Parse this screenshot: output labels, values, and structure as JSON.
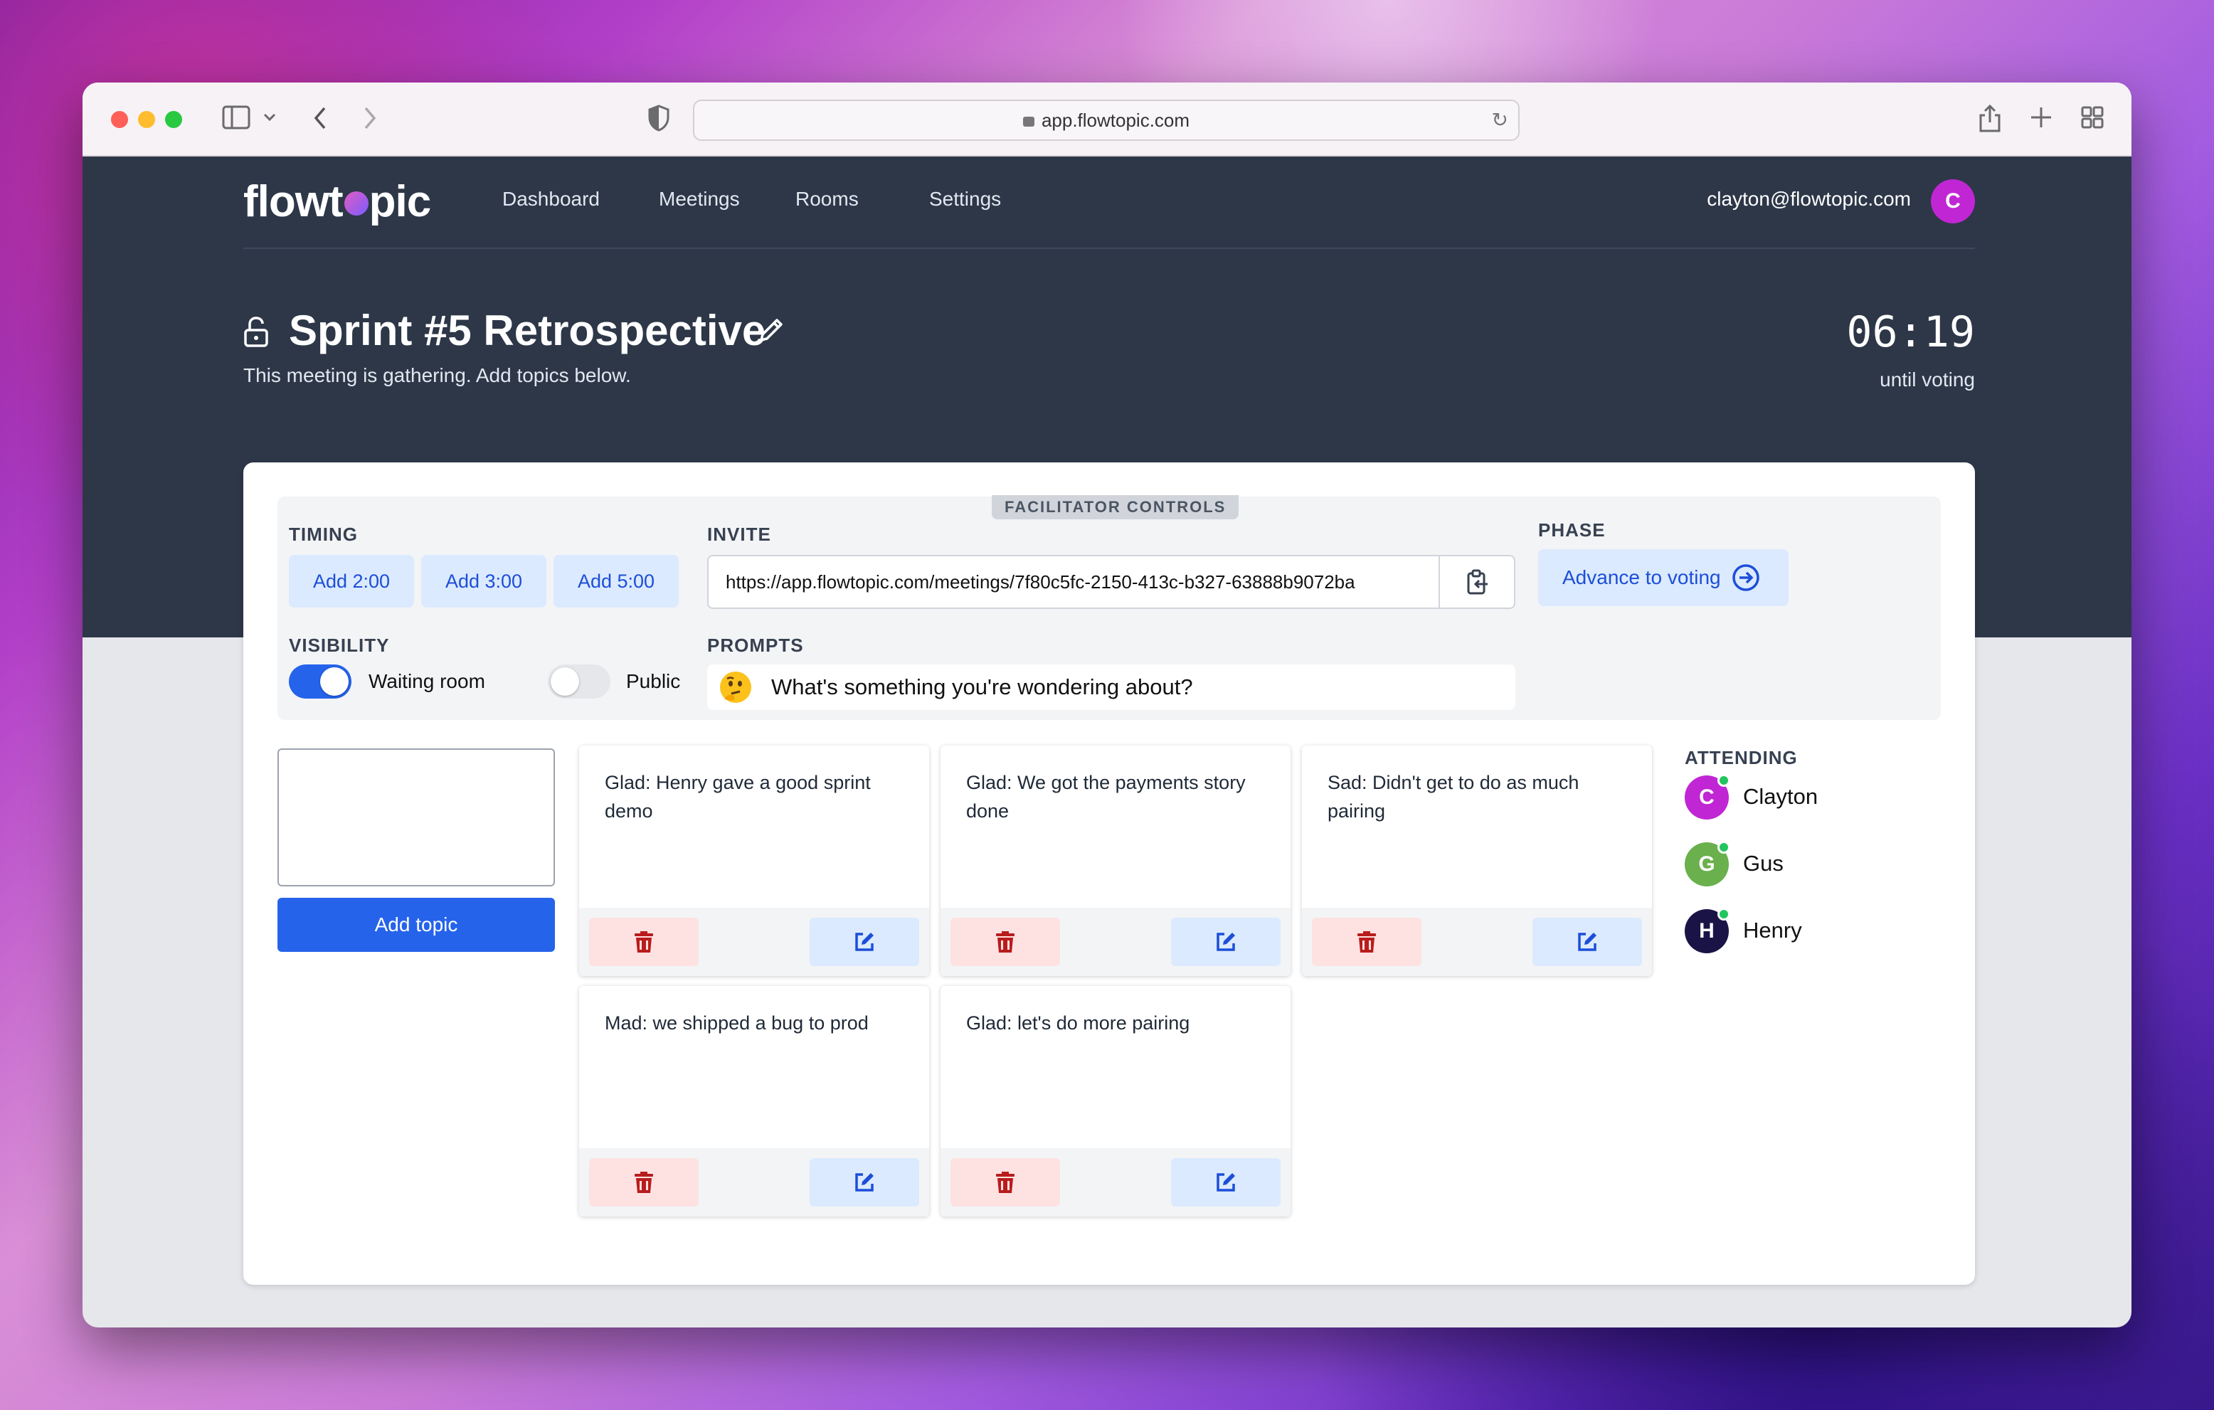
{
  "browser": {
    "url": "app.flowtopic.com"
  },
  "nav": {
    "logo": {
      "before": "flowt",
      "after": "pic"
    },
    "links": [
      "Dashboard",
      "Meetings",
      "Rooms",
      "Settings"
    ],
    "user_email": "clayton@flowtopic.com",
    "user_initial": "C"
  },
  "meeting": {
    "title": "Sprint #5 Retrospective",
    "status": "This meeting is gathering. Add topics below.",
    "timer": "06:19",
    "timer_label": "until voting"
  },
  "facilitator": {
    "badge": "FACILITATOR CONTROLS",
    "timing_label": "TIMING",
    "timing_buttons": [
      "Add 2:00",
      "Add 3:00",
      "Add 5:00"
    ],
    "invite_label": "INVITE",
    "invite_url": "https://app.flowtopic.com/meetings/7f80c5fc-2150-413c-b327-63888b9072ba",
    "phase_label": "PHASE",
    "advance_label": "Advance to voting",
    "visibility_label": "VISIBILITY",
    "waiting_room_label": "Waiting room",
    "waiting_room_on": true,
    "public_label": "Public",
    "public_on": false,
    "prompts_label": "PROMPTS",
    "prompt": "What's something you're wondering about?"
  },
  "composer": {
    "add_topic_label": "Add topic",
    "textarea_value": ""
  },
  "topics": [
    "Glad: Henry gave a good sprint demo",
    "Glad: We got the payments story done",
    "Sad: Didn't get to do as much pairing",
    "Mad: we shipped a bug to prod",
    "Glad: let's do more pairing"
  ],
  "attending": {
    "label": "ATTENDING",
    "people": [
      {
        "initial": "C",
        "name": "Clayton",
        "color": "#c026d3"
      },
      {
        "initial": "G",
        "name": "Gus",
        "color": "#6ab04c"
      },
      {
        "initial": "H",
        "name": "Henry",
        "color": "#1a1446"
      }
    ]
  },
  "colors": {
    "accent": "#2563eb",
    "dark_header": "#2d3748",
    "delete_icon": "#b91c1c",
    "edit_icon": "#1d4ed8",
    "online": "#22c55e"
  }
}
